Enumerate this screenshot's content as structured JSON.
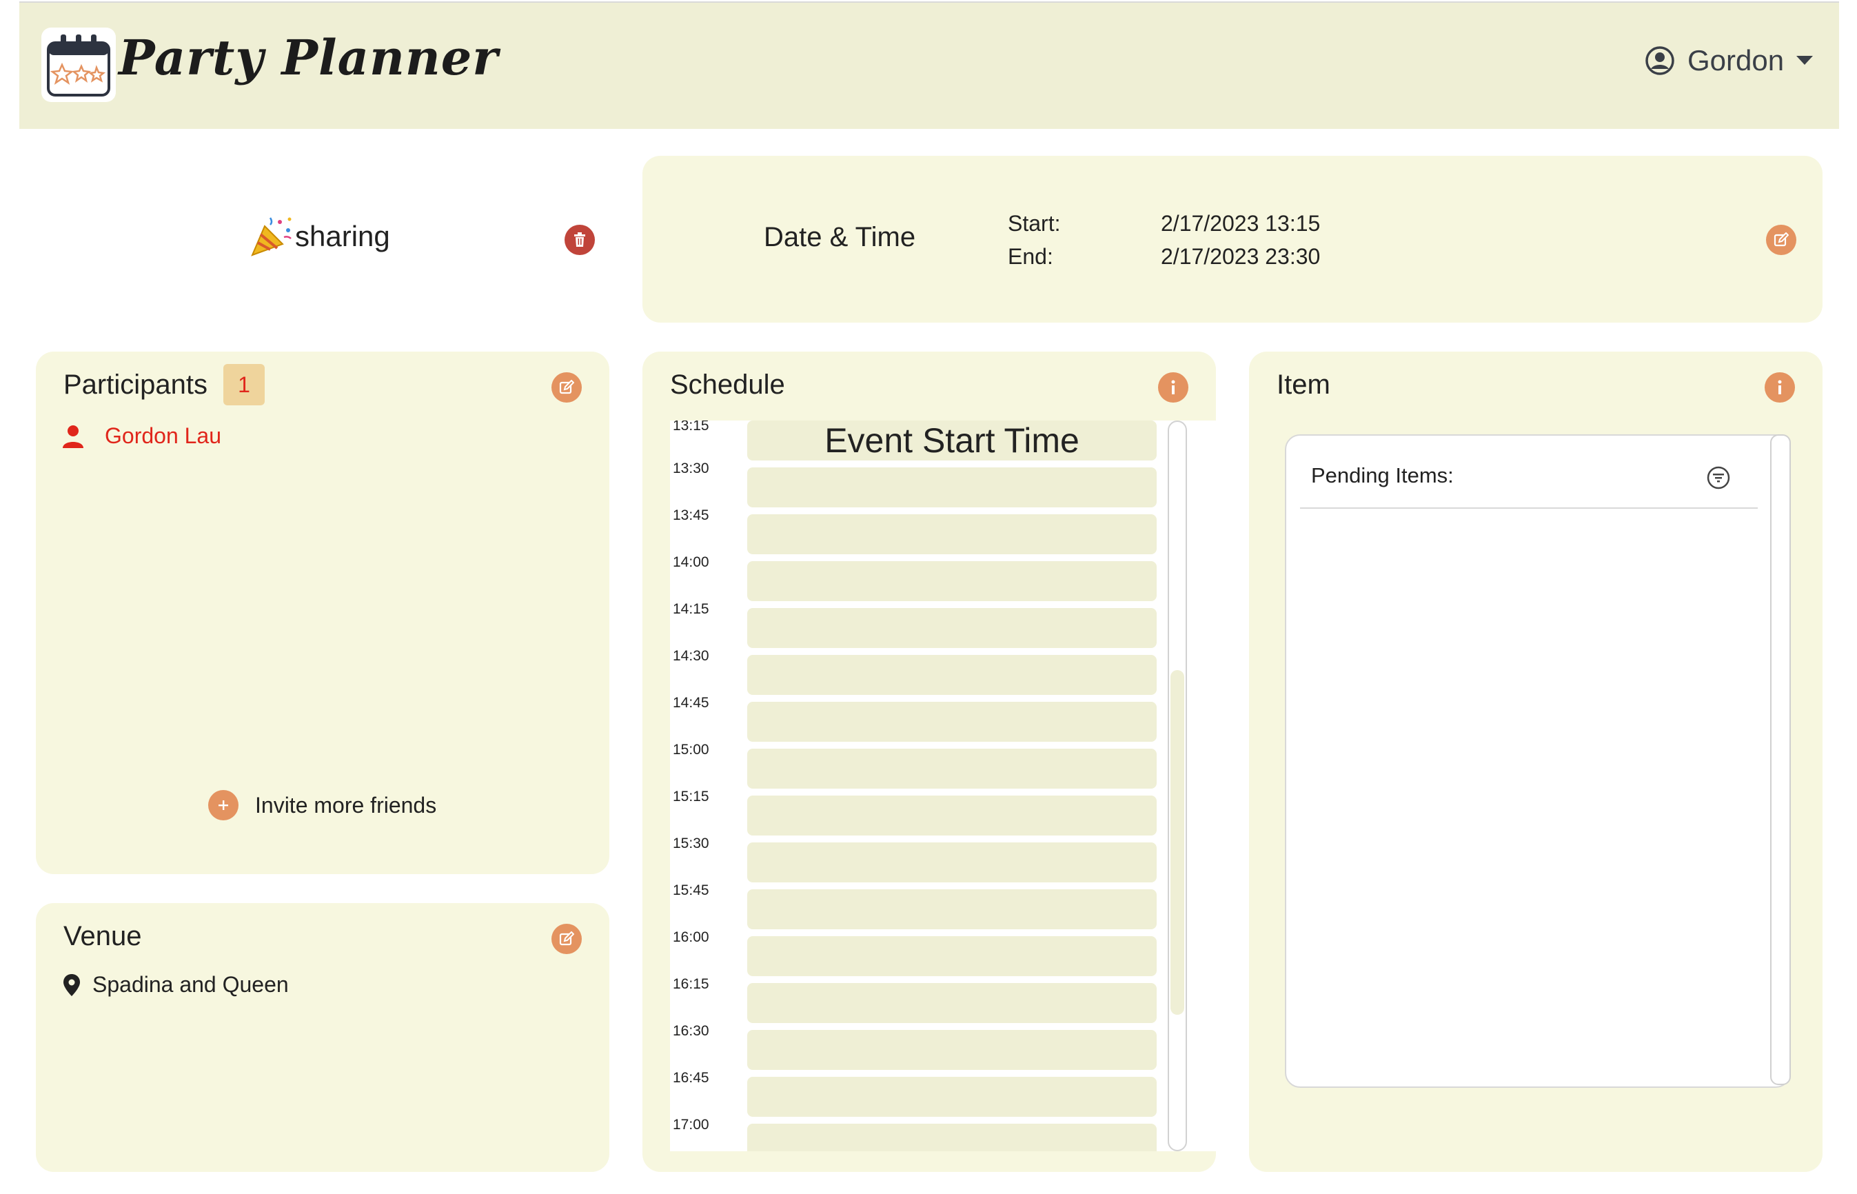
{
  "app": {
    "title": "Party Planner"
  },
  "user": {
    "name": "Gordon"
  },
  "event": {
    "name": "sharing"
  },
  "datetime": {
    "title": "Date & Time",
    "start_label": "Start:",
    "start_value": "2/17/2023 13:15",
    "end_label": "End:",
    "end_value": "2/17/2023 23:30"
  },
  "participants": {
    "title": "Participants",
    "count": "1",
    "people": [
      "Gordon Lau"
    ],
    "invite_label": "Invite more friends"
  },
  "venue": {
    "title": "Venue",
    "location": "Spadina and Queen"
  },
  "schedule": {
    "title": "Schedule",
    "first_label": "Event Start Time",
    "times": [
      "13:15",
      "13:30",
      "13:45",
      "14:00",
      "14:15",
      "14:30",
      "14:45",
      "15:00",
      "15:15",
      "15:30",
      "15:45",
      "16:00",
      "16:15",
      "16:30",
      "16:45",
      "17:00"
    ]
  },
  "item": {
    "title": "Item",
    "pending_label": "Pending Items:"
  },
  "colors": {
    "accent": "#e49360",
    "danger": "#c0443a",
    "card_bg": "#f7f7df",
    "topbar_bg": "#efefd5",
    "participant_red": "#e0261b"
  },
  "icons": {
    "logo": "calendar-stars-icon",
    "user": "user-circle-icon",
    "caret": "caret-down-icon",
    "party": "party-popper-icon",
    "trash": "trash-icon",
    "edit": "edit-icon",
    "info": "info-icon",
    "person": "person-icon",
    "add": "plus-icon",
    "pin": "map-pin-icon",
    "filter": "filter-icon"
  }
}
